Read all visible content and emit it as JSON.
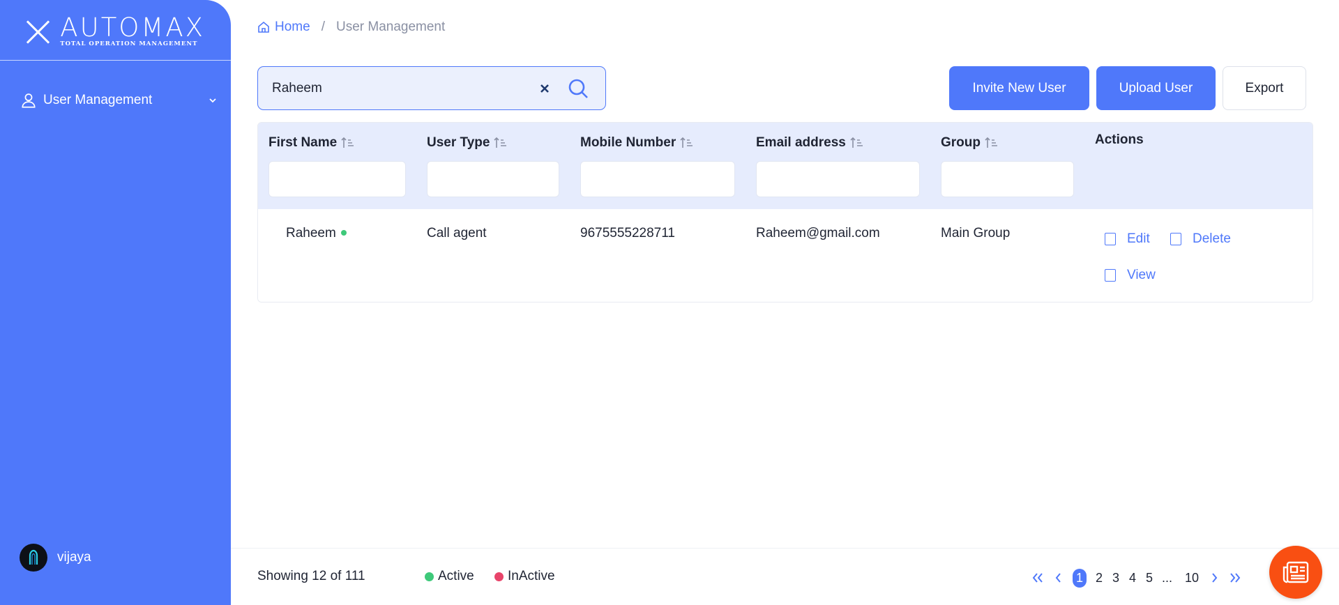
{
  "app": {
    "logo_main": "AUTOMAX",
    "logo_sub": "TOTAL OPERATION MANAGEMENT"
  },
  "sidebar": {
    "items": [
      {
        "label": "User Management",
        "icon": "user-icon"
      }
    ],
    "profile": {
      "name": "vijaya"
    }
  },
  "breadcrumb": {
    "home": "Home",
    "separator": "/",
    "current": "User Management"
  },
  "search": {
    "value": "Raheem",
    "placeholder": ""
  },
  "toolbar": {
    "invite_label": "Invite New User",
    "upload_label": "Upload User",
    "export_label": "Export"
  },
  "table": {
    "columns": [
      "First Name",
      "User Type",
      "Mobile Number",
      "Email address",
      "Group",
      "Actions"
    ],
    "rows": [
      {
        "first_name": "Raheem",
        "status": "active",
        "user_type": "Call agent",
        "mobile": "9675555228711",
        "email": "Raheem@gmail.com",
        "group": "Main Group"
      }
    ],
    "actions": {
      "edit": "Edit",
      "delete": "Delete",
      "view": "View"
    }
  },
  "footer": {
    "showing": "Showing 12 of 111",
    "legend": [
      {
        "label": "Active",
        "color": "#3ec97a"
      },
      {
        "label": "InActive",
        "color": "#e8446a"
      }
    ],
    "pagination": {
      "current": "1",
      "pages": [
        "2",
        "3",
        "4",
        "5"
      ],
      "ellipsis": "...",
      "last": "10"
    }
  },
  "colors": {
    "accent": "#4f78fa",
    "fab": "#f94f12",
    "header_bg": "#e6ecfd"
  }
}
